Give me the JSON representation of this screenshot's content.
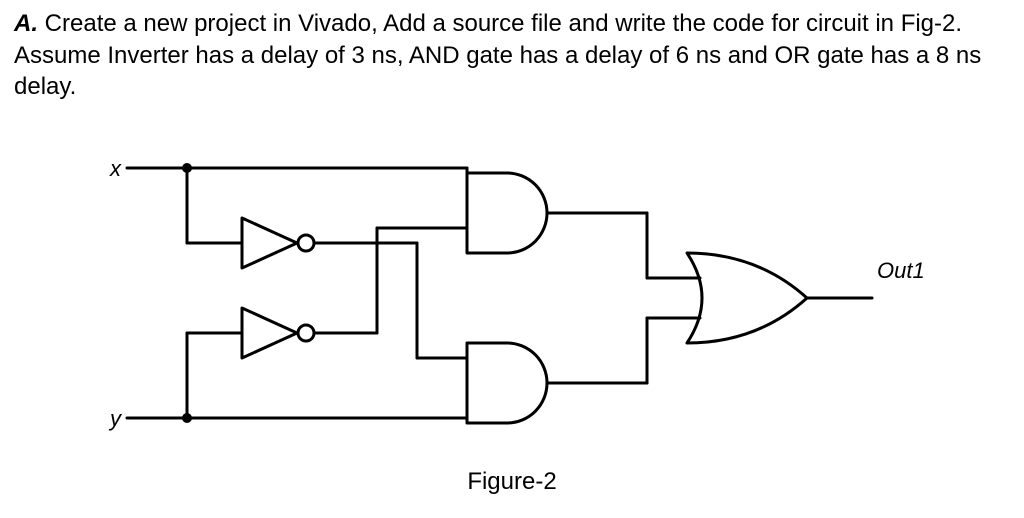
{
  "question": {
    "label": "A.",
    "text_part1": " Create a new project in Vivado, Add a source file and write the code for circuit in Fig-2. Assume Inverter has a delay of ",
    "delay_inv": "3 ns",
    "text_part2": ", AND gate has a delay of ",
    "delay_and": "6 ns",
    "text_part3": " and OR gate has a ",
    "delay_or": "8 ns",
    "text_part4": " delay."
  },
  "diagram": {
    "input_x": "x",
    "input_y": "y",
    "output1": "Out1",
    "caption": "Figure-2"
  },
  "gate_delays": {
    "inverter_ns": 3,
    "and_ns": 6,
    "or_ns": 8
  }
}
